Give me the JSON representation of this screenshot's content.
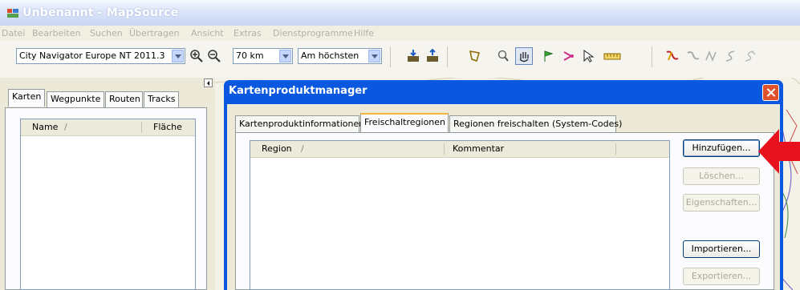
{
  "window": {
    "title": "Unbenannt - MapSource"
  },
  "menu": [
    "Datei",
    "Bearbeiten",
    "Suchen",
    "Übertragen",
    "Ansicht",
    "Extras",
    "Dienstprogramme",
    "Hilfe"
  ],
  "toolbar": {
    "product_select": "City Navigator Europe NT 2011.3",
    "zoom_select": "70 km",
    "detail_select": "Am höchsten"
  },
  "left_panel": {
    "tabs": [
      "Karten",
      "Wegpunkte",
      "Routen",
      "Tracks"
    ],
    "columns": {
      "name": "Name",
      "sort": "/",
      "area": "Fläche"
    }
  },
  "dialog": {
    "title": "Kartenproduktmanager",
    "tabs": [
      "Kartenproduktinformationen",
      "Freischaltregionen",
      "Regionen freischalten (System-Codes)"
    ],
    "columns": {
      "region": "Region",
      "sort": "/",
      "comment": "Kommentar"
    },
    "buttons": {
      "add": "Hinzufügen...",
      "delete": "Löschen...",
      "properties": "Eigenschaften...",
      "import": "Importieren...",
      "export": "Exportieren..."
    }
  },
  "colors": {
    "dialog_frame": "#0a58e0",
    "close_button": "#e0512d",
    "annotation_arrow": "#e8121e",
    "active_tab_highlight": "#f5b73b"
  }
}
